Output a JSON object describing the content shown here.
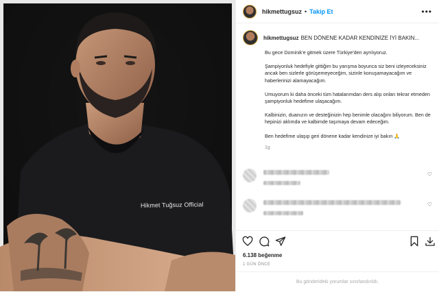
{
  "header": {
    "username": "hikmettugsuz",
    "separator": "•",
    "follow_label": "Takip Et",
    "more_label": "•••"
  },
  "photo": {
    "shirt_text": "Hikmet Tuğsuz Official"
  },
  "caption": {
    "username": "hikmettugsuz",
    "headline": "BEN DÖNENE KADAR KENDİNİZE İYİ BAKIN...",
    "paragraphs": [
      "Bu gece Dominik'e gitmek üzere Türkiye'den ayrılıyoruz.",
      "Şampiyonluk hedefiyle gittiğim bu yarışma boyunca siz beni izleyeceksiniz ancak ben sizlerle görüşemeyeceğim, sizinle konuşamayacağım ve haberlerinizi alamayacağım.",
      "Umuyorum ki daha önceki tüm hatalarımdan ders alıp onları tekrar etmeden şampiyonluk hedefime ulaşacağım.",
      "Kalbinizin, duanızın ve desteğinizin hep benimle olacağını biliyorum. Ben de hepinizi aklımda ve kalbimde taşımaya devam edeceğim.",
      "Ben hedefime ulaşıp geri dönene kadar kendinize iyi bakın 🙏"
    ],
    "time_ago": "1g"
  },
  "icons": {
    "like": "heart-icon",
    "comment": "comment-icon",
    "share": "paper-plane-icon",
    "save": "bookmark-icon",
    "download": "download-icon",
    "comment_like": "heart-icon"
  },
  "stats": {
    "likes": "6.138 beğenme",
    "date": "1 GÜN ÖNCE"
  },
  "comments_notice": "Bu gönderideki yorumlar sınırlandırıldı.",
  "colors": {
    "follow_blue": "#0095f6",
    "text": "#262626",
    "muted": "#8e8e8e",
    "border": "#efefef"
  }
}
